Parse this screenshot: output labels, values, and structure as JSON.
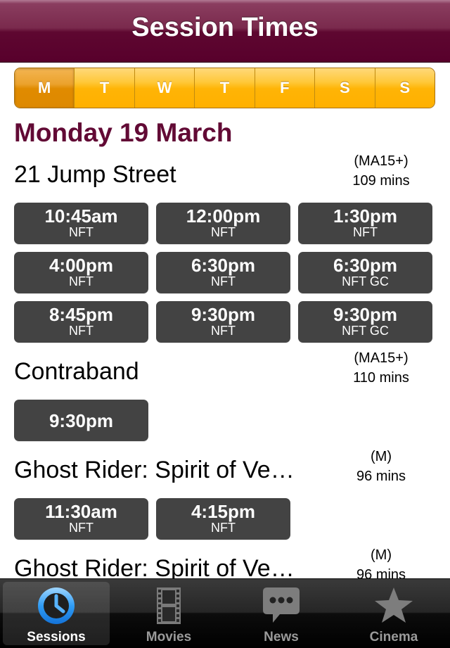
{
  "navbar": {
    "title": "Session Times"
  },
  "days": [
    {
      "label": "M",
      "active": true
    },
    {
      "label": "T",
      "active": false
    },
    {
      "label": "W",
      "active": false
    },
    {
      "label": "T",
      "active": false
    },
    {
      "label": "F",
      "active": false
    },
    {
      "label": "S",
      "active": false
    },
    {
      "label": "S",
      "active": false
    }
  ],
  "date_heading": "Monday 19 March",
  "movies": [
    {
      "title": "21 Jump Street",
      "rating": "(MA15+)",
      "duration": "109 mins",
      "sessions": [
        {
          "time": "10:45am",
          "format": "NFT"
        },
        {
          "time": "12:00pm",
          "format": "NFT"
        },
        {
          "time": "1:30pm",
          "format": "NFT"
        },
        {
          "time": "4:00pm",
          "format": "NFT"
        },
        {
          "time": "6:30pm",
          "format": "NFT"
        },
        {
          "time": "6:30pm",
          "format": "NFT GC"
        },
        {
          "time": "8:45pm",
          "format": "NFT"
        },
        {
          "time": "9:30pm",
          "format": "NFT"
        },
        {
          "time": "9:30pm",
          "format": "NFT GC"
        }
      ]
    },
    {
      "title": "Contraband",
      "rating": "(MA15+)",
      "duration": "110 mins",
      "sessions": [
        {
          "time": "9:30pm",
          "format": ""
        }
      ]
    },
    {
      "title": "Ghost Rider: Spirit of Ve…",
      "rating": "(M)",
      "duration": "96 mins",
      "sessions": [
        {
          "time": "11:30am",
          "format": "NFT"
        },
        {
          "time": "4:15pm",
          "format": "NFT"
        }
      ]
    },
    {
      "title": "Ghost Rider: Spirit of Ve…",
      "rating": "(M)",
      "duration": "96 mins",
      "sessions": []
    }
  ],
  "tabbar": {
    "tabs": [
      {
        "label": "Sessions",
        "icon": "clock-icon",
        "active": true
      },
      {
        "label": "Movies",
        "icon": "film-strip-icon",
        "active": false
      },
      {
        "label": "News",
        "icon": "speech-bubble-icon",
        "active": false
      },
      {
        "label": "Cinema",
        "icon": "star-icon",
        "active": false
      }
    ]
  },
  "colors": {
    "brand": "#5e0730",
    "accent": "#ffb000",
    "session_button": "#434343"
  }
}
